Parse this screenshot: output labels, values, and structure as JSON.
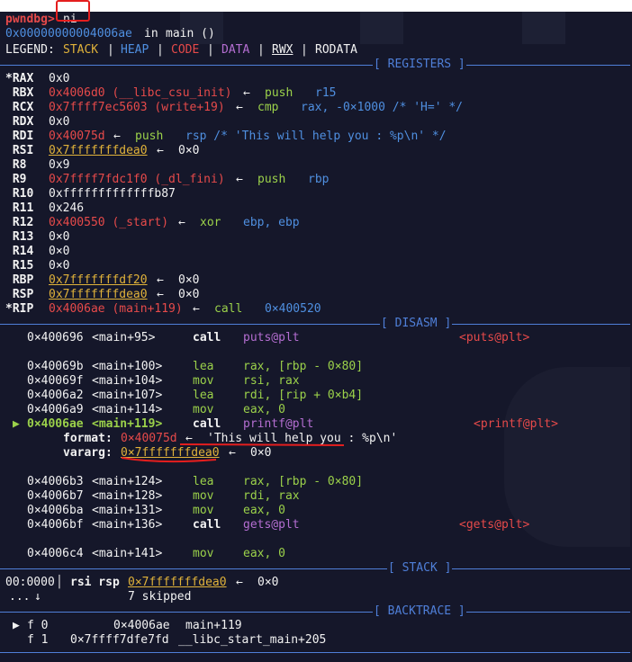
{
  "prompt": {
    "name": "pwndbg>",
    "command": "ni"
  },
  "location": {
    "addr": "0x00000000004006ae",
    "in": "in",
    "func": "main ()"
  },
  "legend": {
    "label": "LEGEND:",
    "stack": "STACK",
    "heap": "HEAP",
    "code": "CODE",
    "data": "DATA",
    "rwx": "RWX",
    "rodata": "RODATA",
    "sep": "|"
  },
  "sections": {
    "registers": "[ REGISTERS ]",
    "disasm": "[ DISASM ]",
    "stack": "[ STACK ]",
    "backtrace": "[ BACKTRACE ]"
  },
  "registers": [
    {
      "name": "*RAX",
      "v": "0x0"
    },
    {
      "name": " RBX",
      "v": "0x4006d0 (__libc_csu_init)",
      "arrow": "←",
      "op": "push",
      "args": "r15"
    },
    {
      "name": " RCX",
      "v": "0x7ffff7ec5603 (write+19)",
      "arrow": "←",
      "op": "cmp",
      "args": "rax, -0×1000 /* 'H=' */"
    },
    {
      "name": " RDX",
      "v": "0x0"
    },
    {
      "name": " RDI",
      "v": "0x40075d",
      "arrow": "←",
      "op": "push",
      "args": "rsp /* 'This will help you : %p\\n' */"
    },
    {
      "name": " RSI",
      "v": "0x7fffffffdea0",
      "arrow": "←",
      "tail": "0×0"
    },
    {
      "name": " R8",
      "v": "0x9"
    },
    {
      "name": " R9",
      "v": "0x7ffff7fdc1f0 (_dl_fini)",
      "arrow": "←",
      "op": "push",
      "args": "rbp"
    },
    {
      "name": " R10",
      "v": "0xfffffffffffffb87"
    },
    {
      "name": " R11",
      "v": "0x246"
    },
    {
      "name": " R12",
      "v": "0x400550 (_start)",
      "arrow": "←",
      "op": "xor",
      "args": "ebp, ebp"
    },
    {
      "name": " R13",
      "v": "0×0"
    },
    {
      "name": " R14",
      "v": "0×0"
    },
    {
      "name": " R15",
      "v": "0×0"
    },
    {
      "name": " RBP",
      "v": "0x7fffffffdf20",
      "arrow": "←",
      "tail": "0×0"
    },
    {
      "name": " RSP",
      "v": "0x7fffffffdea0",
      "arrow": "←",
      "tail": "0×0"
    },
    {
      "name": "*RIP",
      "v": "0x4006ae (main+119)",
      "arrow": "←",
      "op": "call",
      "args": "0×400520"
    }
  ],
  "disasm": [
    {
      "addr": "0×400696",
      "loc": "<main+95>",
      "op": "call",
      "args": "puts@plt",
      "target": "<puts@plt>"
    },
    {
      "addr": "0×40069b",
      "loc": "<main+100>",
      "op": "lea",
      "args": "rax, [rbp - 0×80]"
    },
    {
      "addr": "0×40069f",
      "loc": "<main+104>",
      "op": "mov",
      "args": "rsi, rax"
    },
    {
      "addr": "0×4006a2",
      "loc": "<main+107>",
      "op": "lea",
      "args": "rdi, [rip + 0×b4]"
    },
    {
      "addr": "0×4006a9",
      "loc": "<main+114>",
      "op": "mov",
      "args": "eax, 0"
    },
    {
      "addr": "0×4006ae",
      "loc": "<main+119>",
      "op": "call",
      "args": "printf@plt",
      "target": "<printf@plt>",
      "current": true
    },
    {
      "addr": "0×4006b3",
      "loc": "<main+124>",
      "op": "lea",
      "args": "rax, [rbp - 0×80]"
    },
    {
      "addr": "0×4006b7",
      "loc": "<main+128>",
      "op": "mov",
      "args": "rdi, rax"
    },
    {
      "addr": "0×4006ba",
      "loc": "<main+131>",
      "op": "mov",
      "args": "eax, 0"
    },
    {
      "addr": "0×4006bf",
      "loc": "<main+136>",
      "op": "call",
      "args": "gets@plt",
      "target": "<gets@plt>"
    },
    {
      "addr": "0×4006c4",
      "loc": "<main+141>",
      "op": "mov",
      "args": "eax, 0"
    }
  ],
  "call_args": {
    "format_label": "format:",
    "format_addr": "0×40075d",
    "format_arrow": "←",
    "format_str": "'This will help you : %p\\n'",
    "vararg_label": "vararg:",
    "vararg_addr": "0×7fffffffdea0",
    "vararg_arrow": "←",
    "vararg_tail": "0×0"
  },
  "current_marker": "▶",
  "stack": {
    "offset": "00:0000",
    "bar": "│",
    "regs": "rsi rsp",
    "addr": "0×7fffffffdea0",
    "arrow": "←",
    "tail": "0×0",
    "more": "...",
    "more_arrow": "↓",
    "skipped": "7 skipped"
  },
  "backtrace": [
    {
      "marker": "▶",
      "frame": "f 0",
      "addr": "0×4006ae",
      "sym": "main+119"
    },
    {
      "marker": "",
      "frame": "f 1",
      "addr": "0×7ffff7dfe7fd",
      "sym": "__libc_start_main+205"
    }
  ],
  "colors": {
    "bg": "#15172a",
    "accent": "#4f7fd8",
    "code": "#e64a4a",
    "stack": "#e0b23a",
    "heap": "#4f8fe0",
    "data": "#b46ed1",
    "annotation": "#e41e1e"
  }
}
